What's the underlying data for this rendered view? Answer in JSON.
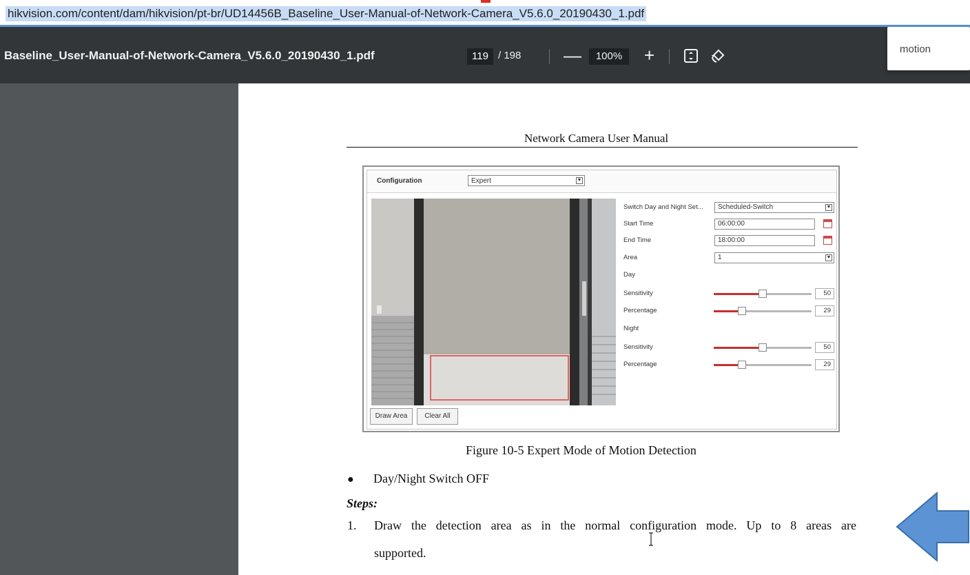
{
  "browser": {
    "url": "hikvision.com/content/dam/hikvision/pt-br/UD14456B_Baseline_User-Manual-of-Network-Camera_V5.6.0_20190430_1.pdf"
  },
  "toolbar": {
    "doc_title": "Baseline_User-Manual-of-Network-Camera_V5.6.0_20190430_1.pdf",
    "page_current": "119",
    "page_total": "/ 198",
    "zoom_minus": "—",
    "zoom": "100%",
    "zoom_plus": "+",
    "search_term": "motion"
  },
  "page": {
    "running_header": "Network Camera User Manual",
    "figure": {
      "config_label": "Configuration",
      "mode_value": "Expert",
      "draw_area": "Draw Area",
      "clear_all": "Clear All",
      "switch_label": "Switch Day and Night Set...",
      "switch_value": "Scheduled-Switch",
      "start_label": "Start Time",
      "start_value": "06:00:00",
      "end_label": "End Time",
      "end_value": "18:00:00",
      "area_label": "Area",
      "area_value": "1",
      "day_label": "Day",
      "night_label": "Night",
      "sensitivity_label": "Sensitivity",
      "percentage_label": "Percentage",
      "day_sensitivity": "50",
      "day_percentage": "29",
      "night_sensitivity": "50",
      "night_percentage": "29",
      "sensitivity_level": 0.5,
      "percentage_level": 0.29
    },
    "caption": "Figure 10-5 Expert Mode of Motion Detection",
    "bullet_symbol": "●",
    "bullet_text": "Day/Night Switch OFF",
    "steps_heading": "Steps:",
    "step1_num": "1.",
    "step1_text": "Draw the detection area as in the normal configuration mode. Up to 8 areas are",
    "step1_cont": "supported."
  },
  "colors": {
    "toolbar_bg": "#323639",
    "viewer_bg": "#525659",
    "url_highlight": "#c8dcf5",
    "slider_fill": "#c62f2f",
    "annotation_arrow": "#5b93d4"
  }
}
